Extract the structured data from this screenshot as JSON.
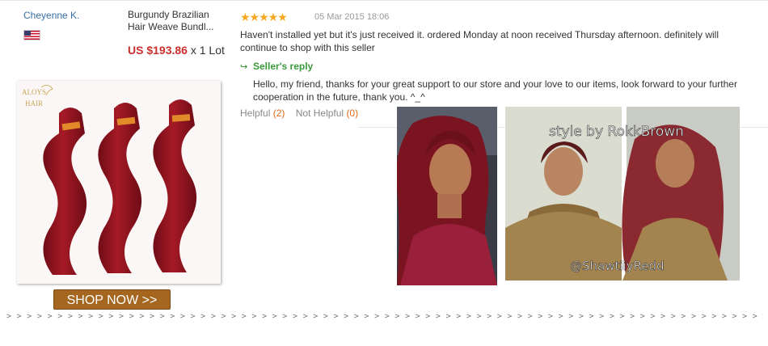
{
  "buyer": {
    "name": "Cheyenne K.",
    "country_flag": "us-flag-icon"
  },
  "product": {
    "title": "Burgundy Brazilian Hair Weave Bundl...",
    "price_prefix": "US $193.86",
    "price_suffix": " x 1 Lot"
  },
  "review": {
    "rating": 5,
    "stars": "★★★★★",
    "date": "05 Mar 2015 18:06",
    "text": "Haven't installed yet but it's just received it. ordered Monday at noon received Thursday afternoon. definitely will continue to shop with this seller"
  },
  "seller_reply": {
    "icon": "↪",
    "label": "Seller's reply",
    "text": "Hello, my friend, thanks for your great support to our store and your love to our items, look forward to your further cooperation in the future, thank you. ^_^"
  },
  "feedback": {
    "helpful_label": "Helpful",
    "helpful_count": "(2)",
    "not_helpful_label": "Not Helpful",
    "not_helpful_count": "(0)"
  },
  "promo": {
    "brand_logo": "ALOYS HAIR",
    "shop_button": "SHOP NOW >>"
  },
  "photos": {
    "caption_top": "style by RokkBrown",
    "caption_bottom": "@ShawtiiyRedd"
  },
  "divider": "> > > > > > > > > > > > > > > > > > > > > > > > > > > > > > > > > > > > > > > > > > > > > > > > > > > > > > > > > > > > > > > > > > > > > > > > > > > > > > > > > > > > > > > > > > > > > > > > > > > > > > > > > > > > > > > > > > > > > > > > > > > > > > > > > > > > > > > > > > > > > > > > > > > > > > >",
  "colors": {
    "accent_price": "#c9302c",
    "stars": "#f7a81e",
    "link": "#3770a8",
    "reply_green": "#3a9a3a",
    "shop_button": "#a5671f",
    "hair": "#8e1420"
  }
}
